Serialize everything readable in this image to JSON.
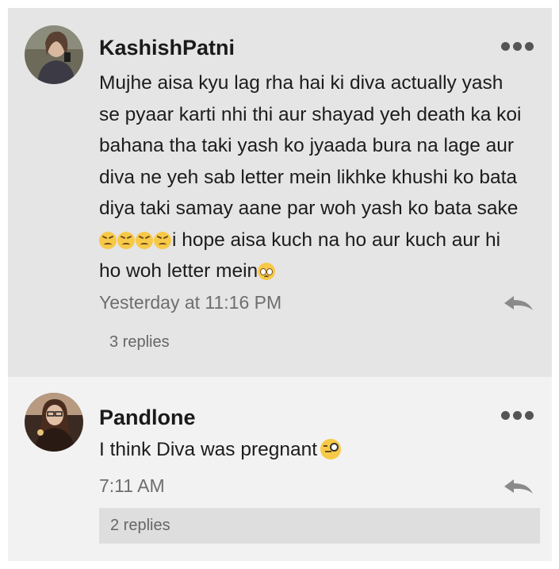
{
  "comments": [
    {
      "author": "KashishPatni",
      "text_lines": [
        "Mujhe aisa kyu lag rha hai ki diva actually yash",
        "se pyaar karti nhi thi aur shayad yeh death ka koi",
        "bahana tha taki yash ko jyaada bura na lage aur",
        "diva ne yeh sab letter mein likhke khushi ko bata",
        "diya taki samay aane par woh yash ko bata sake"
      ],
      "line6": "i hope aisa kuch na ho aur kuch aur hi",
      "line7": "ho woh letter mein",
      "timestamp": "Yesterday at 11:16 PM",
      "replies": "3 replies",
      "avatar_icon": "user-avatar-photo",
      "emoji": [
        "persevering-face",
        "persevering-face",
        "persevering-face",
        "persevering-face",
        "pleading-face"
      ]
    },
    {
      "author": "Pandlone",
      "text": "I think Diva was pregnant",
      "timestamp": "7:11 AM",
      "replies": "2 replies",
      "avatar_icon": "user-avatar-photo",
      "emoji": [
        "face-with-monocle"
      ]
    }
  ],
  "icons": {
    "more": "more-options-icon",
    "reply": "reply-arrow-icon"
  },
  "colors": {
    "comment1_bg": "#e5e5e5",
    "comment2_bg": "#f2f2f2",
    "replies_box": "#dedede"
  }
}
